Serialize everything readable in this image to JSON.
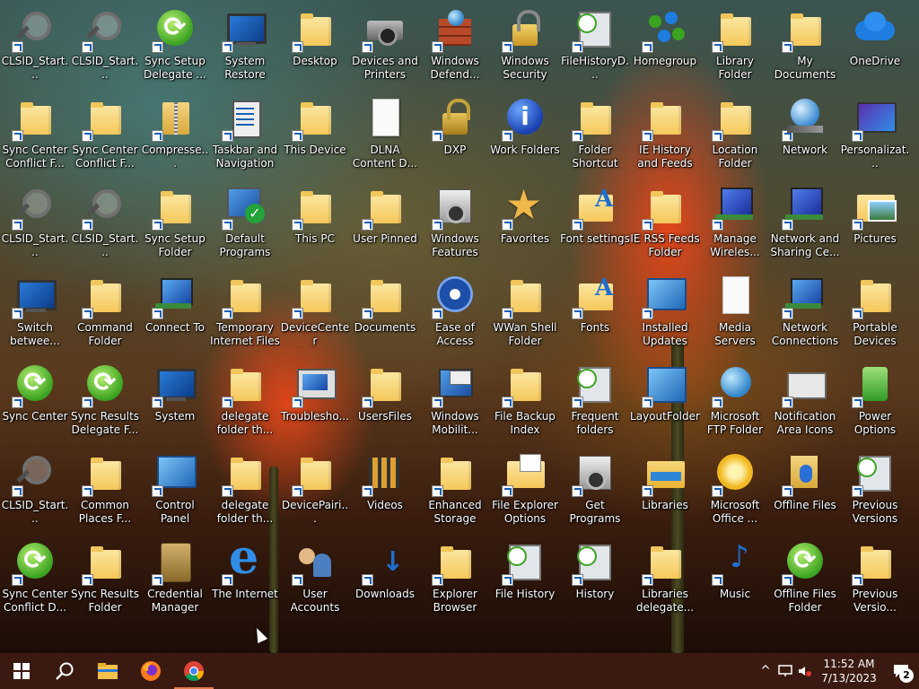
{
  "desktop": {
    "icons": [
      {
        "label": "CLSID_Start...",
        "glyph": "search",
        "shortcut": true
      },
      {
        "label": "Sync Center Conflict F...",
        "glyph": "folder",
        "shortcut": true
      },
      {
        "label": "CLSID_Start...",
        "glyph": "search",
        "shortcut": true
      },
      {
        "label": "Switch betwee...",
        "glyph": "monitor",
        "shortcut": true
      },
      {
        "label": "Sync Center",
        "glyph": "sync",
        "shortcut": true
      },
      {
        "label": "CLSID_Start...",
        "glyph": "search",
        "shortcut": true
      },
      {
        "label": "Sync Center Conflict D...",
        "glyph": "sync",
        "shortcut": true
      },
      {
        "label": "CLSID_Start...",
        "glyph": "search",
        "shortcut": true
      },
      {
        "label": "Sync Center Conflict F...",
        "glyph": "folder",
        "shortcut": true
      },
      {
        "label": "CLSID_Start...",
        "glyph": "search",
        "shortcut": true
      },
      {
        "label": "Command Folder",
        "glyph": "folder",
        "shortcut": true
      },
      {
        "label": "Sync Results Delegate F...",
        "glyph": "sync",
        "shortcut": true
      },
      {
        "label": "Common Places F...",
        "glyph": "folder",
        "shortcut": true
      },
      {
        "label": "Sync Results Folder",
        "glyph": "folder",
        "shortcut": true
      },
      {
        "label": "Sync Setup Delegate ...",
        "glyph": "sync",
        "shortcut": true
      },
      {
        "label": "Compresse...",
        "glyph": "zip",
        "shortcut": true
      },
      {
        "label": "Sync Setup Folder",
        "glyph": "folder",
        "shortcut": true
      },
      {
        "label": "Connect To",
        "glyph": "netcomp",
        "shortcut": true
      },
      {
        "label": "System",
        "glyph": "monitor",
        "shortcut": true
      },
      {
        "label": "Control Panel",
        "glyph": "control",
        "shortcut": true
      },
      {
        "label": "Credential Manager",
        "glyph": "safe",
        "shortcut": true
      },
      {
        "label": "System Restore",
        "glyph": "monitor",
        "shortcut": true
      },
      {
        "label": "Taskbar and Navigation",
        "glyph": "clipboard",
        "shortcut": true
      },
      {
        "label": "Default Programs",
        "glyph": "check",
        "shortcut": true
      },
      {
        "label": "Temporary Internet Files",
        "glyph": "folder",
        "shortcut": true
      },
      {
        "label": "delegate folder th...",
        "glyph": "folder",
        "shortcut": true
      },
      {
        "label": "delegate folder th...",
        "glyph": "folder",
        "shortcut": true
      },
      {
        "label": "The Internet",
        "glyph": "ie",
        "shortcut": true
      },
      {
        "label": "Desktop",
        "glyph": "folder",
        "shortcut": true
      },
      {
        "label": "This Device",
        "glyph": "folder",
        "shortcut": true
      },
      {
        "label": "This PC",
        "glyph": "folder",
        "shortcut": true
      },
      {
        "label": "DeviceCenter Initialization",
        "glyph": "folder",
        "shortcut": true
      },
      {
        "label": "Troublesho...",
        "glyph": "trouble",
        "shortcut": true
      },
      {
        "label": "DevicePairi... Initialization",
        "glyph": "folder",
        "shortcut": true
      },
      {
        "label": "User Accounts",
        "glyph": "users",
        "shortcut": true
      },
      {
        "label": "Devices and Printers",
        "glyph": "printer",
        "shortcut": true
      },
      {
        "label": "DLNA Content D...",
        "glyph": "doc",
        "shortcut": false
      },
      {
        "label": "User Pinned",
        "glyph": "folder",
        "shortcut": true
      },
      {
        "label": "Documents",
        "glyph": "folder",
        "shortcut": true
      },
      {
        "label": "UsersFiles",
        "glyph": "folder",
        "shortcut": true
      },
      {
        "label": "Videos",
        "glyph": "videos",
        "shortcut": true
      },
      {
        "label": "Downloads",
        "glyph": "arrow",
        "shortcut": true
      },
      {
        "label": "Windows Defend...",
        "glyph": "bricks",
        "shortcut": true
      },
      {
        "label": "DXP",
        "glyph": "dxp",
        "shortcut": true
      },
      {
        "label": "Windows Features",
        "glyph": "features",
        "shortcut": true
      },
      {
        "label": "Ease of Access Center",
        "glyph": "ease",
        "shortcut": true
      },
      {
        "label": "Windows Mobilit...",
        "glyph": "mobility",
        "shortcut": true
      },
      {
        "label": "Enhanced Storage Da...",
        "glyph": "folder",
        "shortcut": true
      },
      {
        "label": "Explorer Browser Res...",
        "glyph": "folder",
        "shortcut": true
      },
      {
        "label": "Windows Security",
        "glyph": "lock",
        "shortcut": true
      },
      {
        "label": "Work Folders",
        "glyph": "info",
        "shortcut": true
      },
      {
        "label": "Favorites",
        "glyph": "star",
        "shortcut": true
      },
      {
        "label": "WWan Shell Folder",
        "glyph": "folder",
        "shortcut": true
      },
      {
        "label": "File Backup Index",
        "glyph": "folder",
        "shortcut": true
      },
      {
        "label": "File Explorer Options",
        "glyph": "exp-opts",
        "shortcut": true
      },
      {
        "label": "File History",
        "glyph": "history",
        "shortcut": true
      },
      {
        "label": "FileHistoryD...",
        "glyph": "history",
        "shortcut": true
      },
      {
        "label": "Folder Shortcut",
        "glyph": "folder",
        "shortcut": true
      },
      {
        "label": "Font settings",
        "glyph": "fonts",
        "shortcut": true
      },
      {
        "label": "Fonts",
        "glyph": "fonts",
        "shortcut": true
      },
      {
        "label": "Frequent folders",
        "glyph": "history",
        "shortcut": true
      },
      {
        "label": "Get Programs",
        "glyph": "features",
        "shortcut": true
      },
      {
        "label": "History",
        "glyph": "history",
        "shortcut": true
      },
      {
        "label": "Homegroup",
        "glyph": "dots",
        "shortcut": true
      },
      {
        "label": "IE History and Feeds Shell ...",
        "glyph": "folder",
        "shortcut": true
      },
      {
        "label": "IE RSS Feeds Folder",
        "glyph": "folder",
        "shortcut": true
      },
      {
        "label": "Installed Updates",
        "glyph": "control",
        "shortcut": true
      },
      {
        "label": "LayoutFolder",
        "glyph": "layout",
        "shortcut": true
      },
      {
        "label": "Libraries",
        "glyph": "folderlib",
        "shortcut": true
      },
      {
        "label": "Libraries delegate...",
        "glyph": "folder",
        "shortcut": true
      },
      {
        "label": "Library Folder",
        "glyph": "folder",
        "shortcut": true
      },
      {
        "label": "Location Folder",
        "glyph": "folder",
        "shortcut": true
      },
      {
        "label": "Manage Wireles...",
        "glyph": "wireless",
        "shortcut": true
      },
      {
        "label": "Media Servers",
        "glyph": "media",
        "shortcut": false
      },
      {
        "label": "Microsoft FTP Folder",
        "glyph": "globe",
        "shortcut": true
      },
      {
        "label": "Microsoft Office ...",
        "glyph": "office",
        "shortcut": true
      },
      {
        "label": "Music",
        "glyph": "music",
        "shortcut": true
      },
      {
        "label": "My Documents",
        "glyph": "folder",
        "shortcut": true
      },
      {
        "label": "Network",
        "glyph": "network",
        "shortcut": true
      },
      {
        "label": "Network and Sharing Ce...",
        "glyph": "wireless",
        "shortcut": true
      },
      {
        "label": "Network Connections",
        "glyph": "netcomp",
        "shortcut": true
      },
      {
        "label": "Notification Area Icons",
        "glyph": "notif",
        "shortcut": true
      },
      {
        "label": "Offline Files",
        "glyph": "offline",
        "shortcut": true
      },
      {
        "label": "Offline Files Folder",
        "glyph": "sync",
        "shortcut": true
      },
      {
        "label": "OneDrive",
        "glyph": "cloud",
        "shortcut": false
      },
      {
        "label": "Personalizat...",
        "glyph": "palette",
        "shortcut": true
      },
      {
        "label": "Pictures",
        "glyph": "pictures",
        "shortcut": true
      },
      {
        "label": "Portable Devices",
        "glyph": "folder",
        "shortcut": true
      },
      {
        "label": "Power Options",
        "glyph": "power",
        "shortcut": true
      },
      {
        "label": "Previous Versions",
        "glyph": "history",
        "shortcut": true
      },
      {
        "label": "Previous Versio...",
        "glyph": "folder",
        "shortcut": true
      }
    ],
    "overlay_label": "CLSID_Start... SearchConn"
  },
  "taskbar": {
    "start_icon": "windows-logo-icon",
    "search_icon": "search-icon",
    "pinned": [
      {
        "name": "file-explorer",
        "icon": "folder-icon"
      },
      {
        "name": "firefox",
        "icon": "firefox-icon"
      },
      {
        "name": "chrome",
        "icon": "chrome-icon",
        "active": true
      }
    ],
    "tray": {
      "chevron": "^",
      "time": "11:52 AM",
      "date": "7/13/2023",
      "notification_count": "2"
    }
  }
}
